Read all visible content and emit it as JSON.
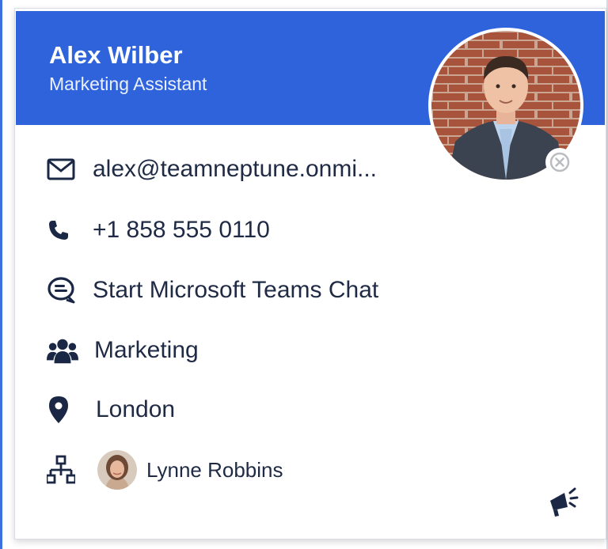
{
  "person": {
    "display_name": "Alex Wilber",
    "job_title": "Marketing Assistant",
    "photo_icon": "person-photo",
    "presence_icon": "offline-x-icon"
  },
  "contact": {
    "email": "alex@teamneptune.onmi...",
    "phone": "+1 858 555 0110",
    "chat": "Start Microsoft Teams Chat",
    "department": "Marketing",
    "location": "London"
  },
  "manager": {
    "name": "Lynne Robbins"
  },
  "colors": {
    "header_bg": "#2e63dc",
    "text_dark": "#1f2a44",
    "icon_dark": "#1b2845"
  },
  "icons": [
    "mail-icon",
    "phone-icon",
    "chat-icon",
    "people-icon",
    "location-icon",
    "org-chart-icon",
    "feedback-megaphone-icon"
  ]
}
